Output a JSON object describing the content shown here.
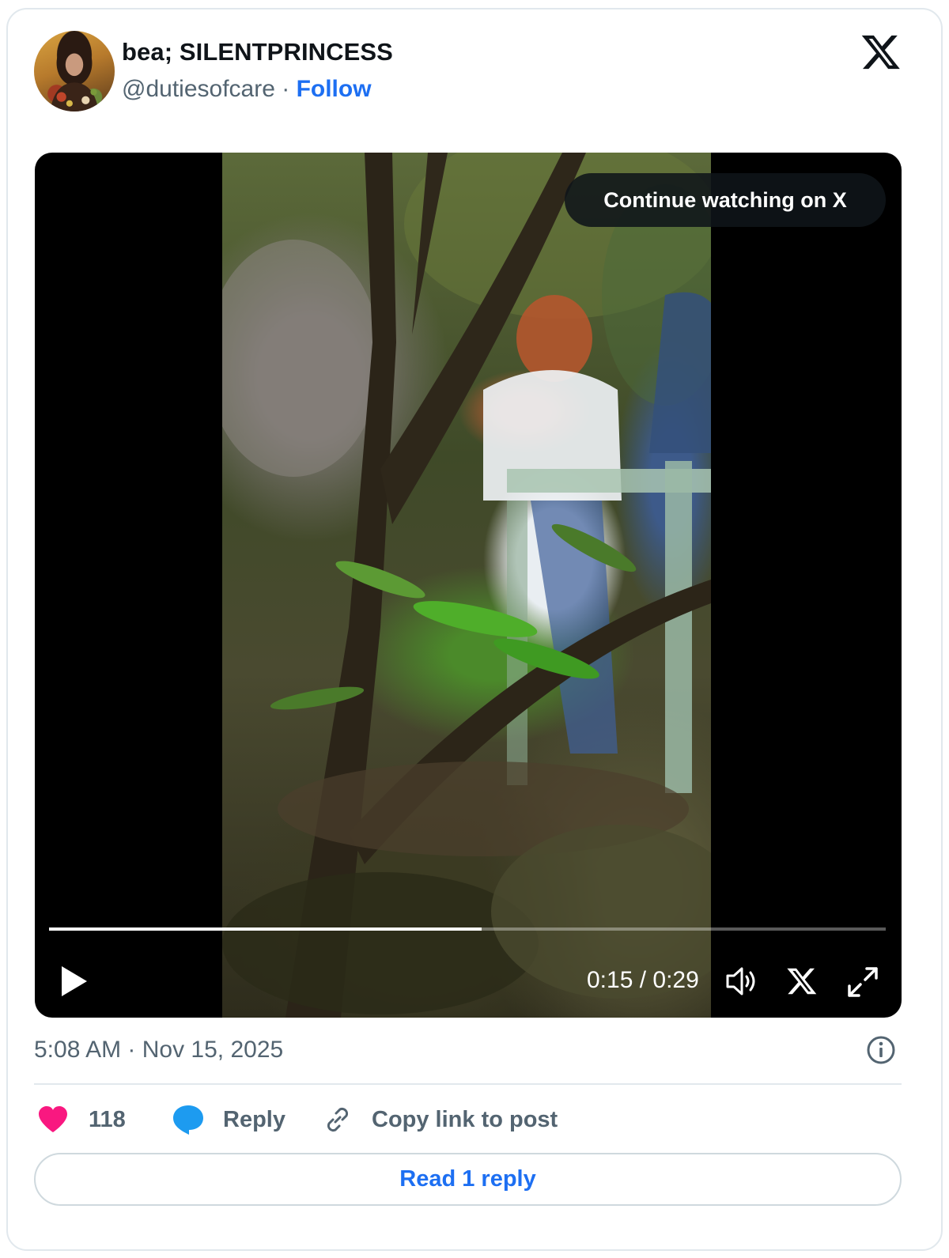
{
  "author": {
    "display_name": "bea; SILENTPRINCESS",
    "handle": "@dutiesofcare",
    "separator": " · ",
    "follow_label": "Follow"
  },
  "video": {
    "overlay_label": "Continue watching on X",
    "current_time": "0:15",
    "duration": "0:29",
    "time_display": "0:15 / 0:29",
    "progress_fraction": 0.517
  },
  "post": {
    "timestamp": "5:08 AM · Nov 15, 2025"
  },
  "actions": {
    "like_count": "118",
    "reply_label": "Reply",
    "copy_link_label": "Copy link to post"
  },
  "read_replies_label": "Read 1 reply",
  "colors": {
    "accent": "#1d6ff2",
    "like": "#f91880",
    "reply": "#1d9bf0",
    "secondary_text": "#536471"
  },
  "icons": [
    "avatar",
    "x-logo-icon",
    "play-icon",
    "volume-icon",
    "x-icon",
    "fullscreen-icon",
    "info-icon",
    "heart-icon",
    "reply-bubble-icon",
    "link-icon"
  ]
}
